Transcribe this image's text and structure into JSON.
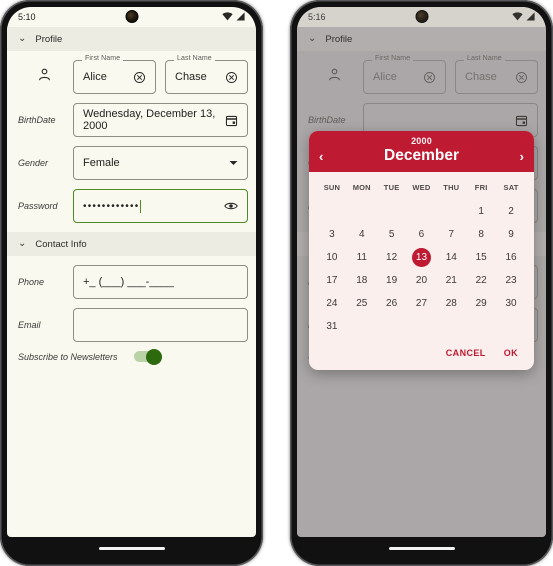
{
  "colors": {
    "accent_red": "#be1a32",
    "dialog_bg": "#fbefed",
    "screen_cream": "#faf9f0",
    "screen_dimmed": "#c4c1c2",
    "focus_green": "#4f8a27",
    "toggle_on": "#2d6a0e"
  },
  "left_phone": {
    "status": {
      "time": "5:10",
      "wifi_icon": "wifi-icon",
      "signal_icon": "signal-icon"
    },
    "sections": {
      "profile": {
        "title": "Profile",
        "chevron": "chevron-down-icon"
      },
      "contact": {
        "title": "Contact Info",
        "chevron": "chevron-down-icon"
      }
    },
    "fields": {
      "person_icon": "person-icon",
      "first_name": {
        "label": "First Name",
        "value": "Alice",
        "clear_icon": "clear-circle-icon"
      },
      "last_name": {
        "label": "Last Name",
        "value": "Chase",
        "clear_icon": "clear-circle-icon"
      },
      "birthdate": {
        "label": "BirthDate",
        "value": "Wednesday, December 13, 2000",
        "trailing_icon": "calendar-icon"
      },
      "gender": {
        "label": "Gender",
        "value": "Female",
        "trailing_icon": "chevron-down-icon"
      },
      "password": {
        "label": "Password",
        "value": "••••••••••••",
        "trailing_icon": "eye-icon"
      },
      "phone": {
        "label": "Phone",
        "value": "+_ (___) ___-____"
      },
      "email": {
        "label": "Email",
        "value": ""
      },
      "subscribe": {
        "label": "Subscribe to Newsletters",
        "state": "on"
      }
    }
  },
  "right_phone": {
    "status": {
      "time": "5:16",
      "wifi_icon": "wifi-icon",
      "signal_icon": "signal-icon"
    },
    "sections": {
      "profile": {
        "title": "Profile",
        "chevron": "chevron-down-icon"
      },
      "contact": {
        "title": "",
        "chevron": "chevron-down-icon"
      }
    },
    "fields": {
      "person_icon": "person-icon",
      "first_name": {
        "label": "First Name",
        "value": "Alice",
        "clear_icon": "clear-circle-icon"
      },
      "last_name": {
        "label": "Last Name",
        "value": "Chase",
        "clear_icon": "clear-circle-icon"
      },
      "birthdate": {
        "label": "BirthDate",
        "value": "",
        "trailing_icon": "calendar-icon"
      },
      "gender": {
        "label": "Gen",
        "value": ""
      },
      "password": {
        "label": "Pas",
        "value": "",
        "trailing_icon": "eye-icon"
      },
      "phone": {
        "label": "Pho",
        "value": ""
      },
      "email": {
        "label": "Ema",
        "value": ""
      },
      "subscribe": {
        "label": "Sub",
        "state": "on"
      }
    },
    "datepicker": {
      "year": "2000",
      "month": "December",
      "prev_icon": "chevron-left-icon",
      "next_icon": "chevron-right-icon",
      "weekdays": [
        "SUN",
        "MON",
        "TUE",
        "WED",
        "THU",
        "FRI",
        "SAT"
      ],
      "weeks": [
        [
          "",
          "",
          "",
          "",
          "",
          "1",
          "2"
        ],
        [
          "3",
          "4",
          "5",
          "6",
          "7",
          "8",
          "9"
        ],
        [
          "10",
          "11",
          "12",
          "13",
          "14",
          "15",
          "16"
        ],
        [
          "17",
          "18",
          "19",
          "20",
          "21",
          "22",
          "23"
        ],
        [
          "24",
          "25",
          "26",
          "27",
          "28",
          "29",
          "30"
        ],
        [
          "31",
          "",
          "",
          "",
          "",
          "",
          ""
        ]
      ],
      "selected_day": "13",
      "cancel_label": "CANCEL",
      "ok_label": "OK"
    }
  }
}
